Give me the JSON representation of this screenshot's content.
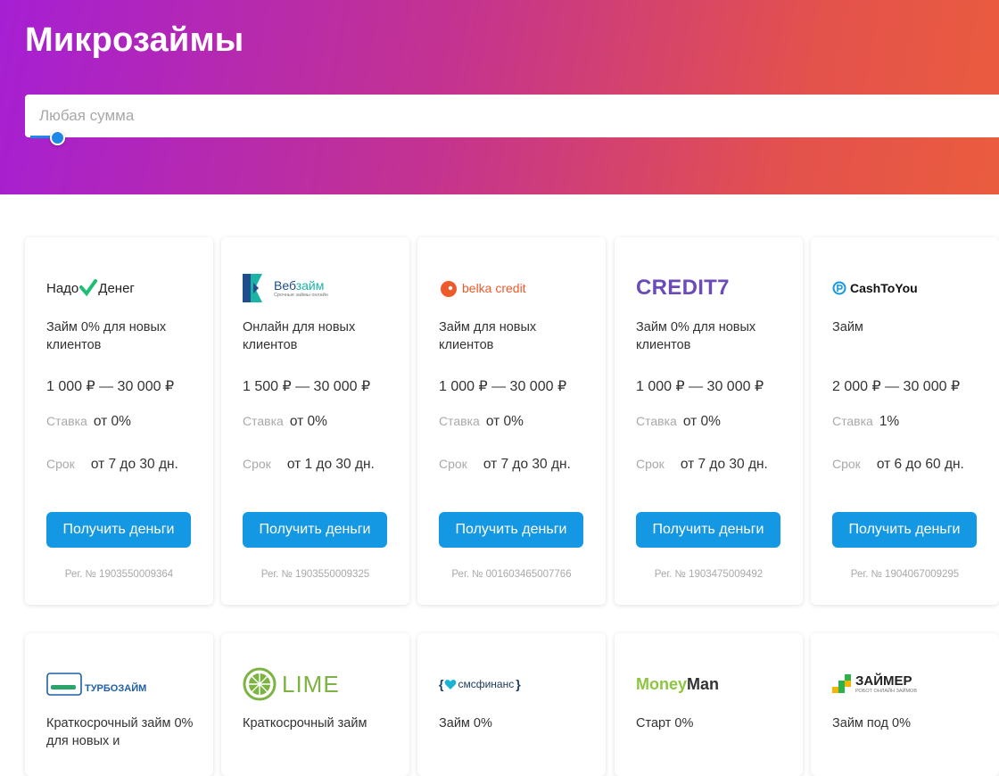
{
  "page": {
    "title": "Микрозаймы"
  },
  "search": {
    "placeholder": "Любая сумма"
  },
  "labels": {
    "rate": "Ставка",
    "term": "Срок"
  },
  "colors": {
    "accent": "#1598e3",
    "hero_start": "#a61fd3",
    "hero_end": "#ea5c3e"
  },
  "offers": [
    {
      "logo": {
        "part1": "Надо",
        "part2": "Денег",
        "check_color": "#1dbf73"
      },
      "description": "Займ 0% для новых клиентов",
      "range": "1 000 ₽ — 30 000 ₽",
      "rate": "от 0%",
      "term": "от 7 до 30 дн.",
      "button": "Получить деньги",
      "reg": "Рег. № 1903550009364"
    },
    {
      "logo": {
        "name_a": "Веб",
        "name_b": "займ",
        "tagline": "Срочные займы онлайн"
      },
      "description": "Онлайн для новых клиентов",
      "range": "1 500 ₽ — 30 000 ₽",
      "rate": "от 0%",
      "term": "от 1 до 30 дн.",
      "button": "Получить деньги",
      "reg": "Рег. № 1903550009325"
    },
    {
      "logo": {
        "name": "belka credit"
      },
      "description": "Займ для новых клиентов",
      "range": "1 000 ₽ — 30 000 ₽",
      "rate": "от 0%",
      "term": "от 7 до 30 дн.",
      "button": "Получить деньги",
      "reg": "Рег. № 001603465007766"
    },
    {
      "logo": {
        "name": "CREDIT7"
      },
      "description": "Займ 0% для новых клиентов",
      "range": "1 000 ₽ — 30 000 ₽",
      "rate": "от 0%",
      "term": "от 7 до 30 дн.",
      "button": "Получить деньги",
      "reg": "Рег. № 1903475009492"
    },
    {
      "logo": {
        "name": "CashToYou"
      },
      "description": "Займ",
      "range": "2 000 ₽ — 30 000 ₽",
      "rate": "1%",
      "term": "от 6 до 60 дн.",
      "button": "Получить деньги",
      "reg": "Рег. № 1904067009295"
    }
  ],
  "offers_row2": [
    {
      "logo": {
        "name": "ТУРБОЗАЙМ"
      },
      "description": "Краткосрочный займ 0% для новых и"
    },
    {
      "logo": {
        "name": "LIME"
      },
      "description": "Краткосрочный займ"
    },
    {
      "logo": {
        "name": "смсфинанс"
      },
      "description": "Займ 0%"
    },
    {
      "logo": {
        "name_a": "Money",
        "name_b": "Man"
      },
      "description": "Старт 0%"
    },
    {
      "logo": {
        "name": "ЗАЙМЕР",
        "tagline": "РОБОТ ОНЛАЙН ЗАЙМОВ"
      },
      "description": "Займ под 0%"
    }
  ]
}
